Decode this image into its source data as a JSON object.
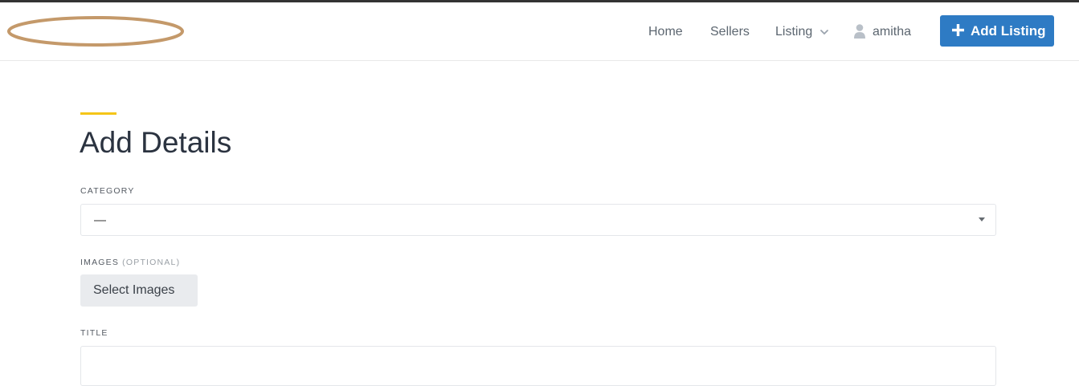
{
  "header": {
    "nav": {
      "home": "Home",
      "sellers": "Sellers",
      "listing": "Listing",
      "user": "amitha"
    },
    "add_listing_label": "Add Listing",
    "brand_color": "#2e7bc4"
  },
  "form": {
    "title": "Add Details",
    "accent_color": "#f5c518",
    "category": {
      "label": "CATEGORY",
      "selected_value": "—"
    },
    "images": {
      "label": "IMAGES",
      "optional_note": "(OPTIONAL)",
      "button_label": "Select Images"
    },
    "title_field": {
      "label": "TITLE",
      "value": ""
    }
  },
  "icons": {
    "listing_dropdown": "chevron-down-icon",
    "user": "user-icon",
    "add": "plus-icon",
    "select": "caret-down-icon"
  }
}
